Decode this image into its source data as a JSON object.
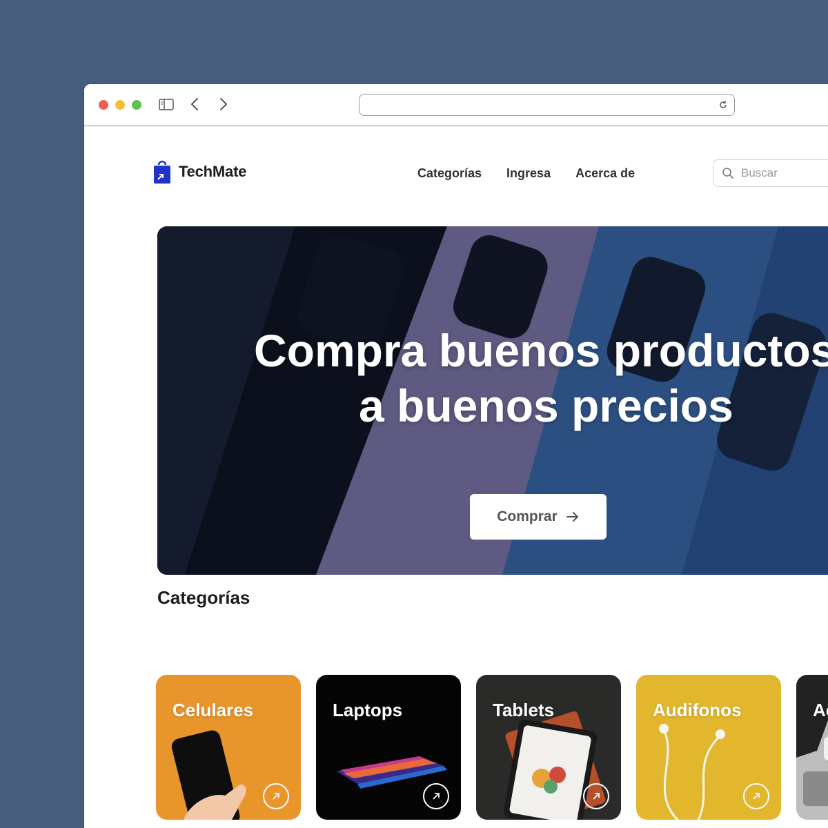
{
  "site": {
    "brand": "TechMate",
    "nav": [
      "Categorías",
      "Ingresa",
      "Acerca de"
    ],
    "search_placeholder": "Buscar"
  },
  "hero": {
    "title_line1": "Compra buenos productos",
    "title_line2": "a buenos precios",
    "cta_label": "Comprar"
  },
  "categories": {
    "heading": "Categorías",
    "items": [
      "Celulares",
      "Laptops",
      "Tablets",
      "Audifonos",
      "Ac"
    ]
  },
  "colors": {
    "brand_blue": "#2233c8",
    "page_bg": "#465d7e",
    "celulares": "#e8952c",
    "laptops": "#050505",
    "tablets": "#2a2a28",
    "audifonos": "#e2b72d"
  }
}
